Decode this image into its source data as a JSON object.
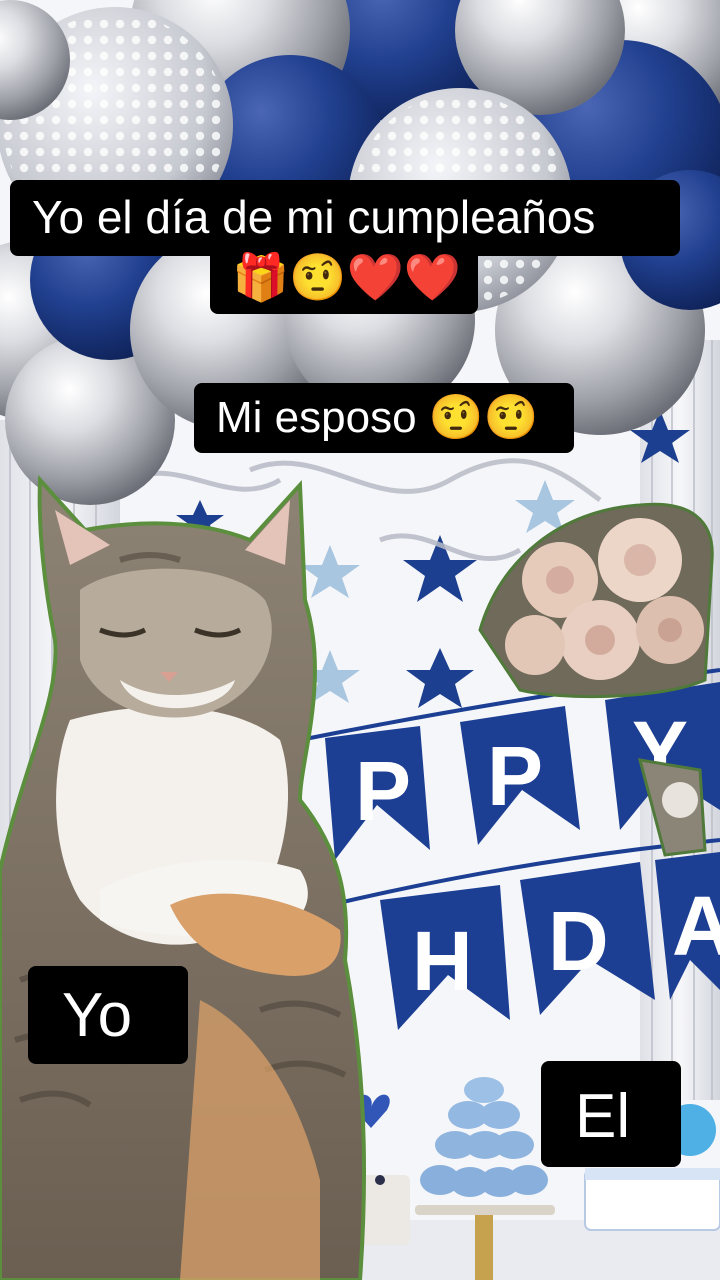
{
  "captions": {
    "title_line1": "Yo el día de mi cumpleaños",
    "title_line2": "🎁🤨❤️❤️",
    "husband_label": "Mi esposo 🤨🤨",
    "me_label": "Yo",
    "him_label": "El"
  },
  "banner": {
    "row1_letters": [
      "P",
      "P",
      "Y"
    ],
    "row2_letters": [
      "H",
      "D",
      "A"
    ]
  },
  "colors": {
    "caption_bg": "#000000",
    "caption_text": "#ffffff",
    "navy_balloon": "#1f3c86",
    "silver_balloon": "#c8c8cc",
    "banner_blue": "#1c3f94"
  }
}
